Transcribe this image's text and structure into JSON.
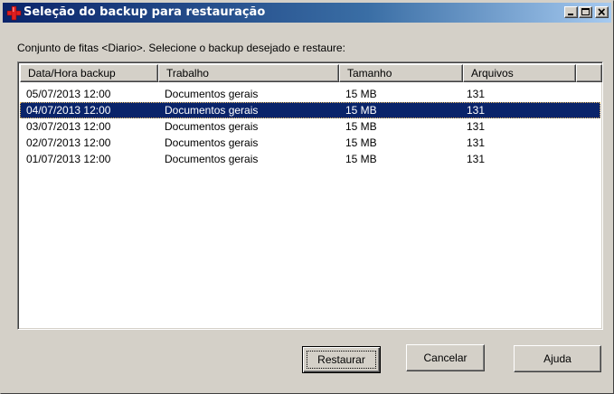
{
  "window": {
    "title": "Seleção do backup para restauração",
    "icon": "red-cross-icon",
    "controls": {
      "minimize": "minimize-icon",
      "maximize": "maximize-icon",
      "close": "close-icon"
    }
  },
  "instruction": "Conjunto de fitas <Diario>. Selecione o backup desejado e restaure:",
  "table": {
    "columns": [
      "Data/Hora backup",
      "Trabalho",
      "Tamanho",
      "Arquivos"
    ],
    "rows": [
      {
        "date": "05/07/2013 12:00",
        "job": "Documentos gerais",
        "size": "15 MB",
        "files": "131"
      },
      {
        "date": "04/07/2013 12:00",
        "job": "Documentos gerais",
        "size": "15 MB",
        "files": "131"
      },
      {
        "date": "03/07/2013 12:00",
        "job": "Documentos gerais",
        "size": "15 MB",
        "files": "131"
      },
      {
        "date": "02/07/2013 12:00",
        "job": "Documentos gerais",
        "size": "15 MB",
        "files": "131"
      },
      {
        "date": "01/07/2013 12:00",
        "job": "Documentos gerais",
        "size": "15 MB",
        "files": "131"
      }
    ],
    "selected_index": 1
  },
  "buttons": {
    "restore": "Restaurar",
    "cancel": "Cancelar",
    "help": "Ajuda"
  },
  "colors": {
    "title_start": "#0a246a",
    "title_end": "#a6caf0",
    "selection": "#0a246a",
    "face": "#d4d0c8"
  }
}
